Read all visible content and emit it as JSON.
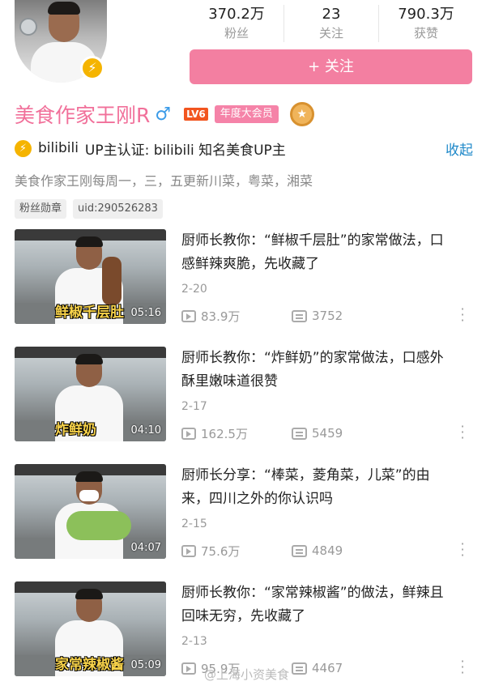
{
  "profile": {
    "name": "美食作家王刚R",
    "gender_symbol": "♂",
    "level": "LV6",
    "vip_label": "年度大会员",
    "cert_prefix": "bilibili",
    "cert_text": "UP主认证: bilibili 知名美食UP主",
    "collapse_label": "收起",
    "signature": "美食作家王刚每周一，三，五更新川菜，粤菜，湘菜",
    "tags": [
      "粉丝勋章",
      "uid:290526283"
    ],
    "follow_button": "+ 关注"
  },
  "stats": [
    {
      "value": "370.2万",
      "label": "粉丝"
    },
    {
      "value": "23",
      "label": "关注"
    },
    {
      "value": "790.3万",
      "label": "获赞"
    }
  ],
  "videos": [
    {
      "title": "厨师长教你：“鲜椒千层肚”的家常做法，口感鲜辣爽脆，先收藏了",
      "date": "2-20",
      "views": "83.9万",
      "danmaku": "3752",
      "caption": "鲜椒千层肚",
      "duration": "05:16"
    },
    {
      "title": "厨师长教你：“炸鲜奶”的家常做法，口感外酥里嫩味道很赞",
      "date": "2-17",
      "views": "162.5万",
      "danmaku": "5459",
      "caption": "炸鲜奶",
      "duration": "04:10"
    },
    {
      "title": "厨师长分享：“棒菜，菱角菜，儿菜”的由来，四川之外的你认识吗",
      "date": "2-15",
      "views": "75.6万",
      "danmaku": "4849",
      "caption": "",
      "duration": "04:07"
    },
    {
      "title": "厨师长教你：“家常辣椒酱”的做法，鲜辣且回味无穷，先收藏了",
      "date": "2-13",
      "views": "95.9万",
      "danmaku": "4467",
      "caption": "家常辣椒酱",
      "duration": "05:09"
    }
  ],
  "watermark": "@上海小资美食",
  "icons": {
    "verified": "lightning-badge-icon",
    "medal": "rank-medal-icon",
    "play": "play-count-icon",
    "danmaku": "danmaku-icon",
    "more": "more-vertical-icon"
  },
  "colors": {
    "accent_pink": "#f37fa1",
    "name_pink": "#f1709a",
    "link_blue": "#1e88c9",
    "verified_yellow": "#f5b400"
  }
}
